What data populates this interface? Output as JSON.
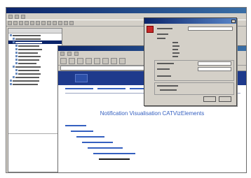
{
  "document": {
    "heading": "Notification Visualisation CATVizElements"
  }
}
